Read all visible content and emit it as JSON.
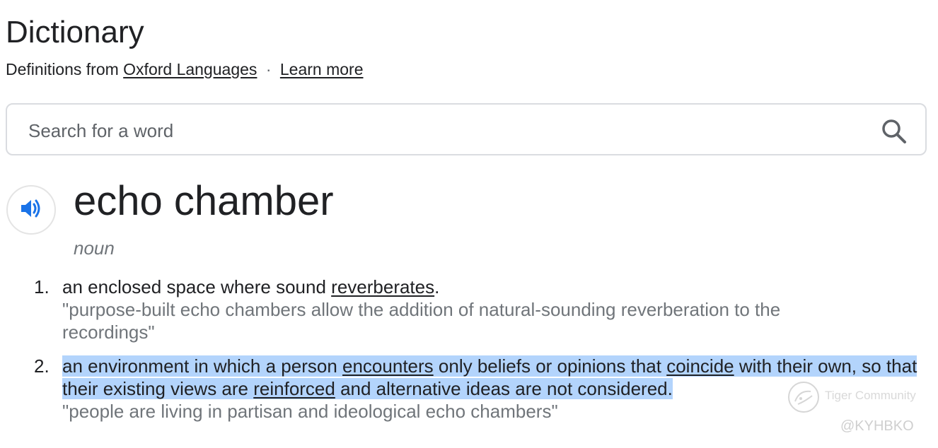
{
  "header": {
    "title": "Dictionary",
    "source_prefix": "Definitions from",
    "source_link": "Oxford Languages",
    "separator": "·",
    "learn_more": "Learn more"
  },
  "search": {
    "placeholder": "Search for a word",
    "value": "",
    "icon": "search-icon"
  },
  "entry": {
    "speaker_icon": "speaker-icon",
    "word": "echo chamber",
    "part_of_speech": "noun",
    "senses": [
      {
        "number": "1.",
        "definition": {
          "before": "an enclosed space where sound ",
          "link": "reverberates",
          "after": "."
        },
        "example": "\"purpose-built echo chambers allow the addition of natural-sounding reverberation to the recordings\""
      },
      {
        "number": "2.",
        "definition": {
          "part1": "an environment in which a person ",
          "link1": "encounters",
          "part2": " only beliefs or opinions that ",
          "link2": "coincide",
          "part3": " with their own, so that their existing views are ",
          "link3": "reinforced",
          "part4": " and alternative ideas are not considered."
        },
        "example": "\"people are living in partisan and ideological echo chambers\"",
        "highlighted": true
      }
    ]
  },
  "watermark": {
    "text": "Tiger Community",
    "handle": "@KYHBKO"
  },
  "colors": {
    "text": "#202124",
    "secondary": "#70757a",
    "accent_blue": "#1a73e8",
    "highlight": "#b3d4fc",
    "border": "#dadce0"
  }
}
